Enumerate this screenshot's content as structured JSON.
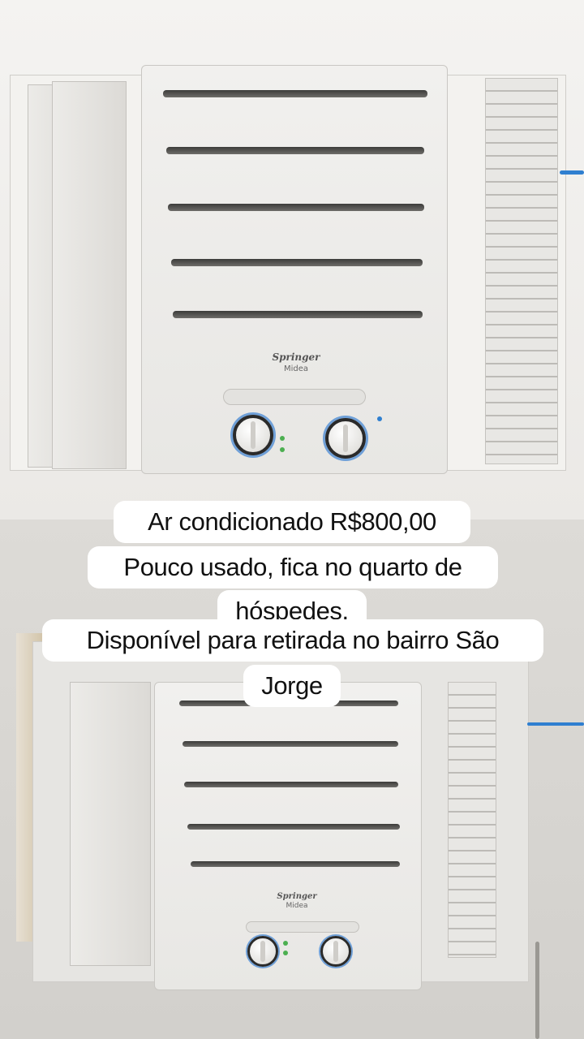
{
  "caption": {
    "lines": [
      "Ar condicionado R$800,00",
      "Pouco usado, fica no quarto de",
      "hóspedes.",
      "Disponível para retirada no bairro São",
      "Jorge"
    ]
  },
  "appliance": {
    "brand": "Springer",
    "sub_brand": "Midea"
  },
  "colors": {
    "caption_bg": "#ffffff",
    "caption_text": "#111111",
    "knob_ring": "#6fa0d8",
    "cable": "#2f7fd0"
  },
  "icons": [
    "air-conditioner-photo",
    "temperature-knob",
    "fan-knob"
  ]
}
